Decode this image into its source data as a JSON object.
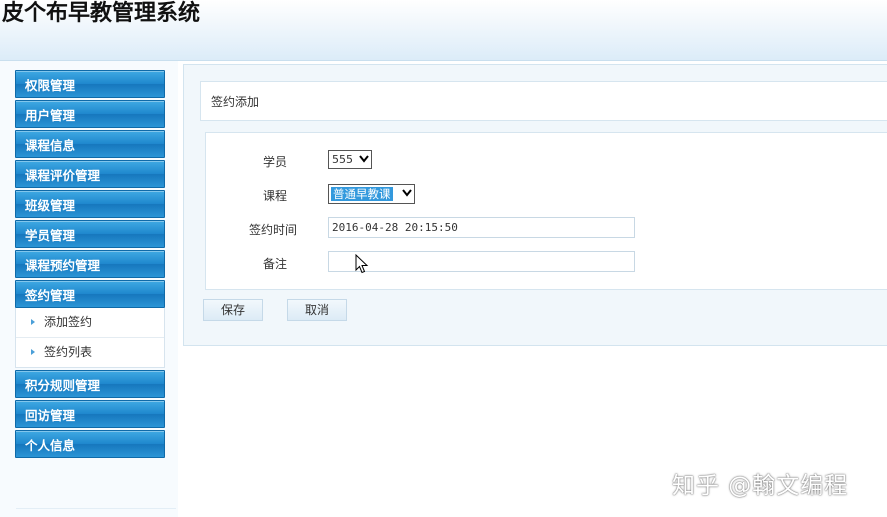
{
  "app": {
    "title": "皮个布早教管理系统"
  },
  "sidebar": {
    "items": [
      {
        "label": "权限管理"
      },
      {
        "label": "用户管理"
      },
      {
        "label": "课程信息"
      },
      {
        "label": "课程评价管理"
      },
      {
        "label": "班级管理"
      },
      {
        "label": "学员管理"
      },
      {
        "label": "课程预约管理"
      },
      {
        "label": "签约管理",
        "expanded": true,
        "children": [
          {
            "label": "添加签约"
          },
          {
            "label": "签约列表"
          }
        ]
      },
      {
        "label": "积分规则管理"
      },
      {
        "label": "回访管理"
      },
      {
        "label": "个人信息"
      }
    ]
  },
  "main": {
    "title": "签约添加",
    "form": {
      "student_label": "学员",
      "student_value": "555",
      "course_label": "课程",
      "course_value": "普通早教课",
      "time_label": "签约时间",
      "time_value": "2016-04-28 20:15:50",
      "note_label": "备注",
      "note_value": ""
    },
    "buttons": {
      "save": "保存",
      "cancel": "取消"
    }
  },
  "watermark": "知乎 @翰文编程",
  "colors": {
    "menu_blue": "#1e87cd",
    "panel_bg": "#f1f7fb",
    "select_highlight": "#3399dd"
  }
}
